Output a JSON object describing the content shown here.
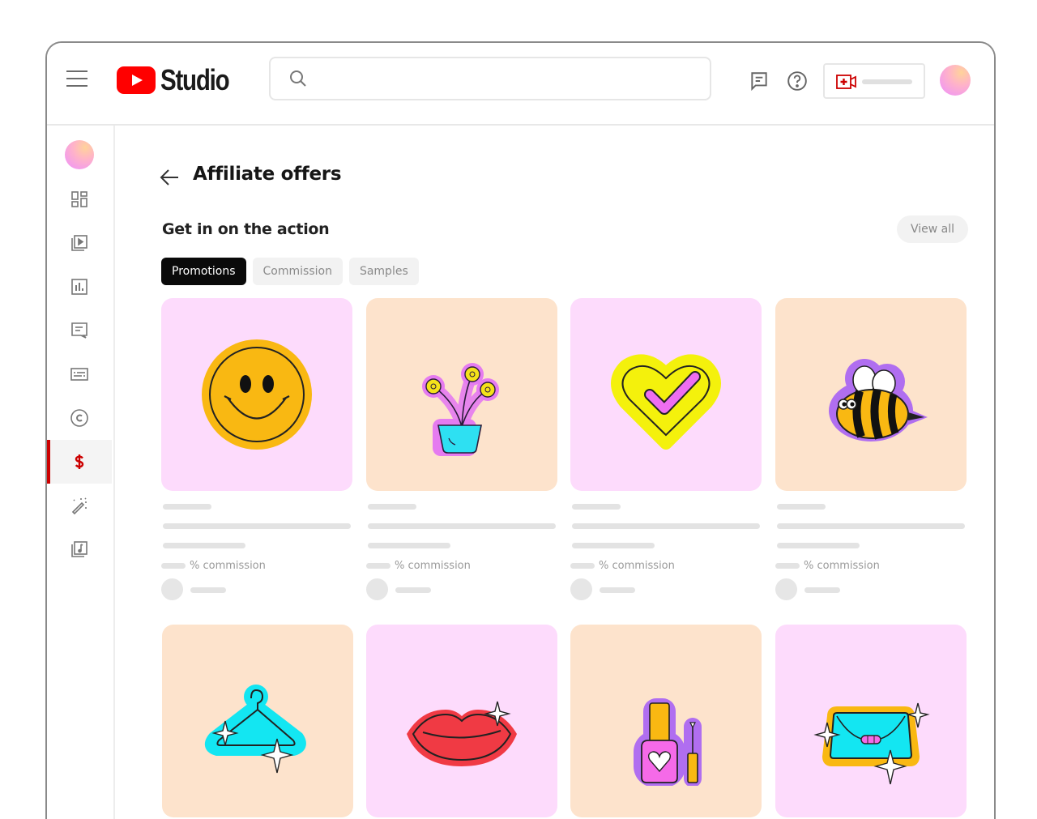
{
  "app": {
    "name": "Studio",
    "brand_color": "#ff0000",
    "accent_color": "#cc0000"
  },
  "topbar": {
    "menu_icon": "hamburger-menu-icon",
    "search": {
      "placeholder": "",
      "value": "",
      "icon": "search-icon"
    },
    "icons": [
      "feedback-icon",
      "help-icon"
    ],
    "create_button": {
      "icon": "create-video-icon",
      "label_placeholder": true
    },
    "avatar": "account-avatar"
  },
  "sidebar": {
    "items": [
      {
        "name": "dashboard",
        "icon": "dashboard-icon",
        "active": false
      },
      {
        "name": "content",
        "icon": "content-icon",
        "active": false
      },
      {
        "name": "analytics",
        "icon": "analytics-icon",
        "active": false
      },
      {
        "name": "comments",
        "icon": "comments-icon",
        "active": false
      },
      {
        "name": "subtitles",
        "icon": "subtitles-icon",
        "active": false
      },
      {
        "name": "copyright",
        "icon": "copyright-icon",
        "active": false
      },
      {
        "name": "earn",
        "icon": "dollar-icon",
        "active": true
      },
      {
        "name": "customization",
        "icon": "magic-wand-icon",
        "active": false
      },
      {
        "name": "audio-library",
        "icon": "audio-library-icon",
        "active": false
      }
    ]
  },
  "main": {
    "title": "Affiliate offers",
    "section_title": "Get in on the action",
    "view_all_label": "View all",
    "chips": [
      {
        "label": "Promotions",
        "active": true
      },
      {
        "label": "Commission",
        "active": false
      },
      {
        "label": "Samples",
        "active": false
      }
    ],
    "commission_label": "% commission",
    "cards": [
      {
        "illustration": "smiley-face",
        "bg": "#fddbfc"
      },
      {
        "illustration": "flower-pot",
        "bg": "#fde3cc"
      },
      {
        "illustration": "heart-check",
        "bg": "#fddbfc"
      },
      {
        "illustration": "bee",
        "bg": "#fde3cc"
      },
      {
        "illustration": "clothes-hanger",
        "bg": "#fde3cc"
      },
      {
        "illustration": "lips",
        "bg": "#fddbfc"
      },
      {
        "illustration": "nail-polish",
        "bg": "#fde3cc"
      },
      {
        "illustration": "clutch-bag",
        "bg": "#fddbfc"
      }
    ]
  }
}
